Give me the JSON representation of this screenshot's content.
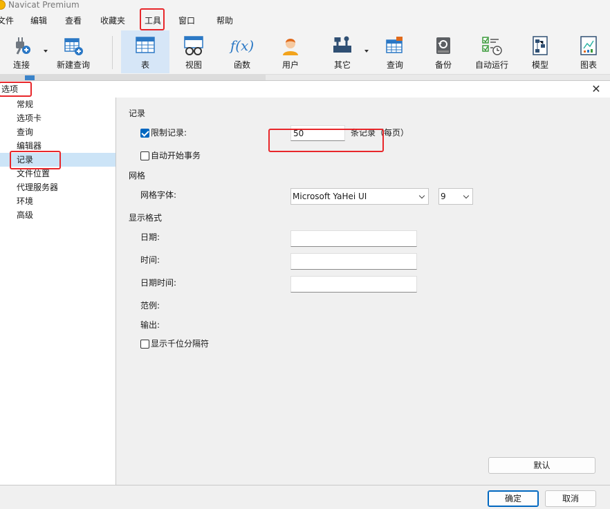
{
  "app": {
    "title": "Navicat Premium"
  },
  "menubar": {
    "items": [
      "文件",
      "编辑",
      "查看",
      "收藏夹",
      "工具",
      "窗口",
      "帮助"
    ]
  },
  "toolbar": {
    "items": [
      {
        "label": "连接",
        "icon": "plug-icon"
      },
      {
        "label": "新建查询",
        "icon": "new-query-icon"
      },
      {
        "label": "表",
        "icon": "table-icon"
      },
      {
        "label": "视图",
        "icon": "view-icon"
      },
      {
        "label": "函数",
        "icon": "function-icon"
      },
      {
        "label": "用户",
        "icon": "user-icon"
      },
      {
        "label": "其它",
        "icon": "tools-icon"
      },
      {
        "label": "查询",
        "icon": "query-icon"
      },
      {
        "label": "备份",
        "icon": "backup-icon"
      },
      {
        "label": "自动运行",
        "icon": "automation-icon"
      },
      {
        "label": "模型",
        "icon": "model-icon"
      },
      {
        "label": "图表",
        "icon": "chart-icon"
      }
    ],
    "function_glyph": "f(x)"
  },
  "dialog": {
    "title": "选项",
    "sidebar": [
      "常规",
      "选项卡",
      "查询",
      "编辑器",
      "记录",
      "文件位置",
      "代理服务器",
      "环境",
      "高级"
    ],
    "selected": "记录",
    "records": {
      "section": "记录",
      "limit_label": "限制记录:",
      "limit_checked": true,
      "limit_value": "50",
      "limit_suffix": "条记录（每页）",
      "auto_transaction_label": "自动开始事务",
      "auto_transaction_checked": false
    },
    "grid": {
      "section": "网格",
      "font_label": "网格字体:",
      "font_value": "Microsoft YaHei UI",
      "size_value": "9"
    },
    "format": {
      "section": "显示格式",
      "date_label": "日期:",
      "time_label": "时间:",
      "datetime_label": "日期时间:",
      "date_value": "",
      "time_value": "",
      "datetime_value": "",
      "sample_label": "范例:",
      "output_label": "输出:",
      "thousands_label": "显示千位分隔符",
      "thousands_checked": false
    },
    "buttons": {
      "default": "默认",
      "ok": "确定",
      "cancel": "取消"
    },
    "close_glyph": "✕"
  },
  "colors": {
    "accent": "#0067c0",
    "highlight": "#e8262a",
    "selected_bg": "#cce4f7"
  }
}
